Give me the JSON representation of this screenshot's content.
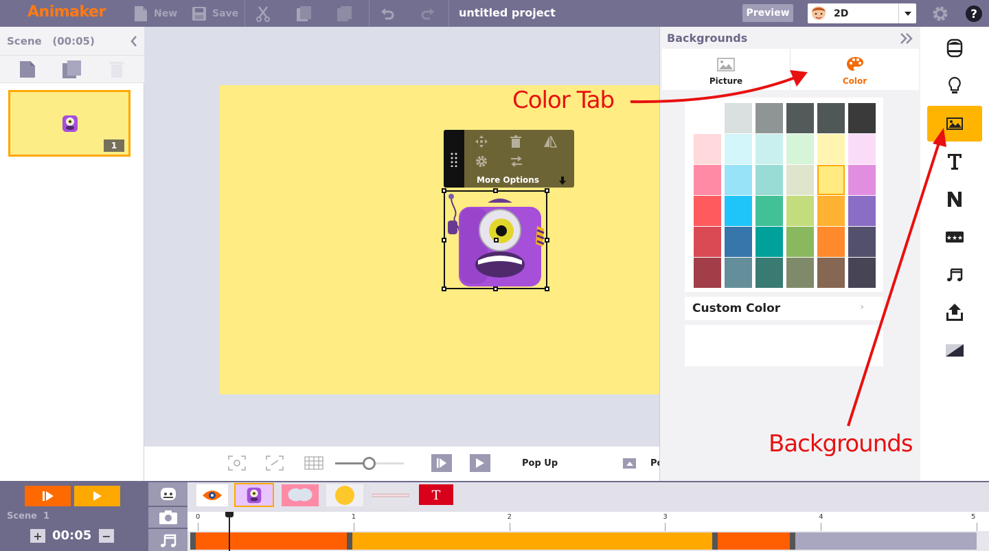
{
  "app": {
    "logo": "Animaker",
    "project_title": "untitled project"
  },
  "toolbar": {
    "new_label": "New",
    "save_label": "Save",
    "preview_label": "Preview",
    "mode_value": "2D"
  },
  "scene_panel": {
    "header": "Scene   (00:05)",
    "thumb_number": "1"
  },
  "popup": {
    "more_options": "More Options"
  },
  "controls": {
    "animation_in": "Pop Up",
    "animation_out": "Po"
  },
  "backgrounds": {
    "title": "Backgrounds",
    "tabs": [
      {
        "label": "Picture"
      },
      {
        "label": "Color"
      }
    ],
    "active_tab": "Color",
    "palette_rows": [
      [
        "#ffffff",
        "#dadfdf",
        "#8f9594",
        "#525a5a",
        "#4f5757",
        "#3a3a3a"
      ],
      [
        "#ffd9db",
        "#d3f6fb",
        "#c9f0ee",
        "#d6f5d8",
        "#fff5b0",
        "#fadcf9"
      ],
      [
        "#ff8aa6",
        "#99e3f8",
        "#99dcd5",
        "#dfe5cd",
        "#ffeb7f",
        "#e28ee0"
      ],
      [
        "#ff5b5f",
        "#1fc5f8",
        "#42c197",
        "#c3dc7d",
        "#ffb132",
        "#8a6dc4"
      ],
      [
        "#d94a55",
        "#3676aa",
        "#00a19a",
        "#8ab85e",
        "#ff8a2c",
        "#52506c"
      ],
      [
        "#a13e48",
        "#648e9a",
        "#397a72",
        "#7f8a6a",
        "#856753",
        "#474455"
      ]
    ],
    "selected_swatch": "#ffeb7f",
    "custom_color_label": "Custom Color"
  },
  "timeline": {
    "scene_label": "Scene  1",
    "duration": "00:05",
    "ruler_ticks": [
      "0",
      "1",
      "2",
      "3",
      "4",
      "5"
    ]
  },
  "annotations": {
    "color_tab": "Color Tab",
    "backgrounds": "Backgrounds"
  },
  "colors": {
    "accent_orange": "#ff6a00",
    "accent_amber": "#ffa800",
    "topbar": "#736f91",
    "annotation_red": "#e81010"
  }
}
